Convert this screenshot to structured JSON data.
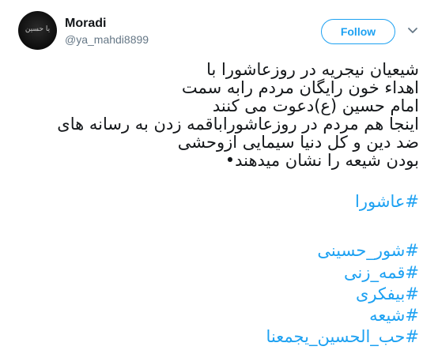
{
  "author": {
    "display_name": "Moradi",
    "handle": "@ya_mahdi8899",
    "avatar_text": "یا حسین"
  },
  "follow_label": "Follow",
  "menu_icon": "chevron-down-icon",
  "tweet": {
    "lines": [
      "شیعیان نیجریه در روزعاشورا با",
      "اهداء خون رایگان مردم رابه سمت",
      "امام حسین (ع)دعوت می کنند",
      "اینجا هم مردم در روزعاشورابا‌قمه زدن به رسانه های",
      "ضد دین و کل دنیا سیمایی ازوحشی",
      "بودن شیعه را نشان میدهند•"
    ],
    "hashtags": [
      "#عاشورا",
      "#شور_حسینی",
      "#قمه_زنی",
      "#بیفکری",
      "#شیعه",
      "#حب_الحسین_یجمعنا"
    ]
  },
  "colors": {
    "link": "#1da1f2",
    "text": "#14171a",
    "muted": "#657786"
  }
}
